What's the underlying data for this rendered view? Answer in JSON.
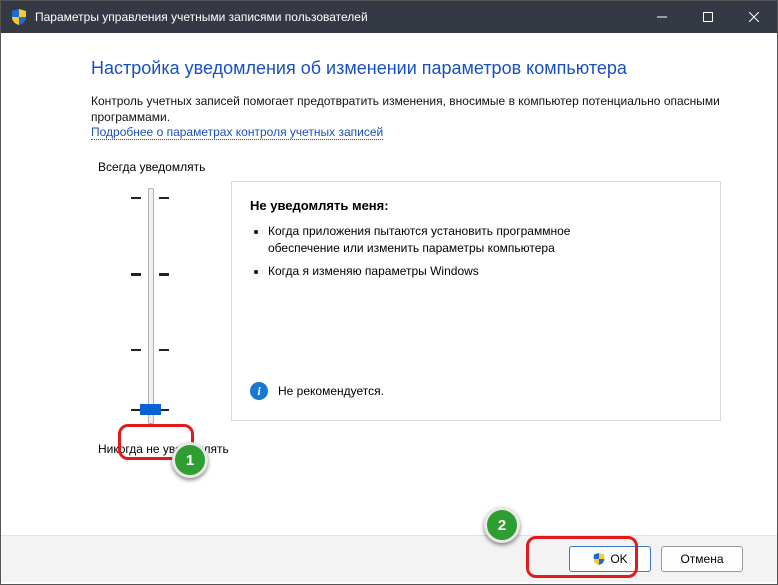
{
  "titlebar": {
    "title": "Параметры управления учетными записями пользователей"
  },
  "content": {
    "heading": "Настройка уведомления об изменении параметров компьютера",
    "description": "Контроль учетных записей помогает предотвратить изменения, вносимые в компьютер потенциально опасными программами.",
    "link": "Подробнее о параметрах контроля учетных записей"
  },
  "slider": {
    "top_label": "Всегда уведомлять",
    "bottom_label": "Никогда не уведомлять"
  },
  "panel": {
    "title": "Не уведомлять меня:",
    "items": [
      "Когда приложения пытаются установить программное обеспечение или изменить параметры компьютера",
      "Когда я изменяю параметры Windows"
    ],
    "footer": "Не рекомендуется."
  },
  "buttons": {
    "ok": "OK",
    "cancel": "Отмена"
  },
  "annotations": {
    "one": "1",
    "two": "2"
  }
}
